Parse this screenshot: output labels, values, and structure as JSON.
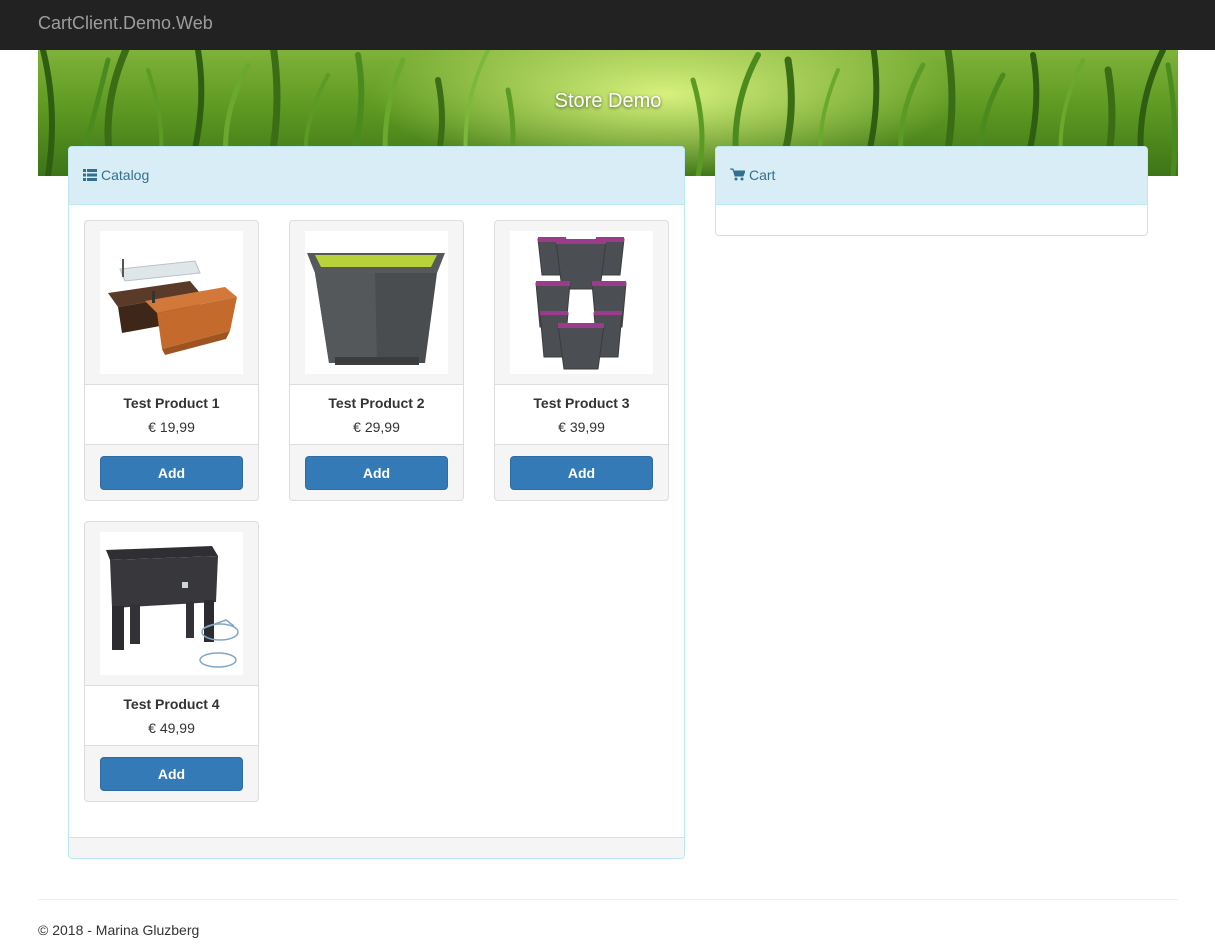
{
  "navbar": {
    "brand": "CartClient.Demo.Web"
  },
  "hero": {
    "title": "Store Demo"
  },
  "catalog": {
    "title": "Catalog",
    "icon": "list-icon",
    "products": [
      {
        "name": "Test Product 1",
        "price": "€ 19,99",
        "button": "Add",
        "image": "planter-boxes-image"
      },
      {
        "name": "Test Product 2",
        "price": "€ 29,99",
        "button": "Add",
        "image": "square-pot-image"
      },
      {
        "name": "Test Product 3",
        "price": "€ 39,99",
        "button": "Add",
        "image": "stacking-pots-image"
      },
      {
        "name": "Test Product 4",
        "price": "€ 49,99",
        "button": "Add",
        "image": "raised-planter-image"
      }
    ]
  },
  "cart": {
    "title": "Cart",
    "icon": "shopping-cart-icon"
  },
  "footer": {
    "copyright": "© 2018 - Marina Gluzberg"
  },
  "colors": {
    "navbar": "#222222",
    "panel_heading_bg": "#d9edf7",
    "panel_heading_text": "#31708f",
    "primary_button": "#337ab7"
  }
}
